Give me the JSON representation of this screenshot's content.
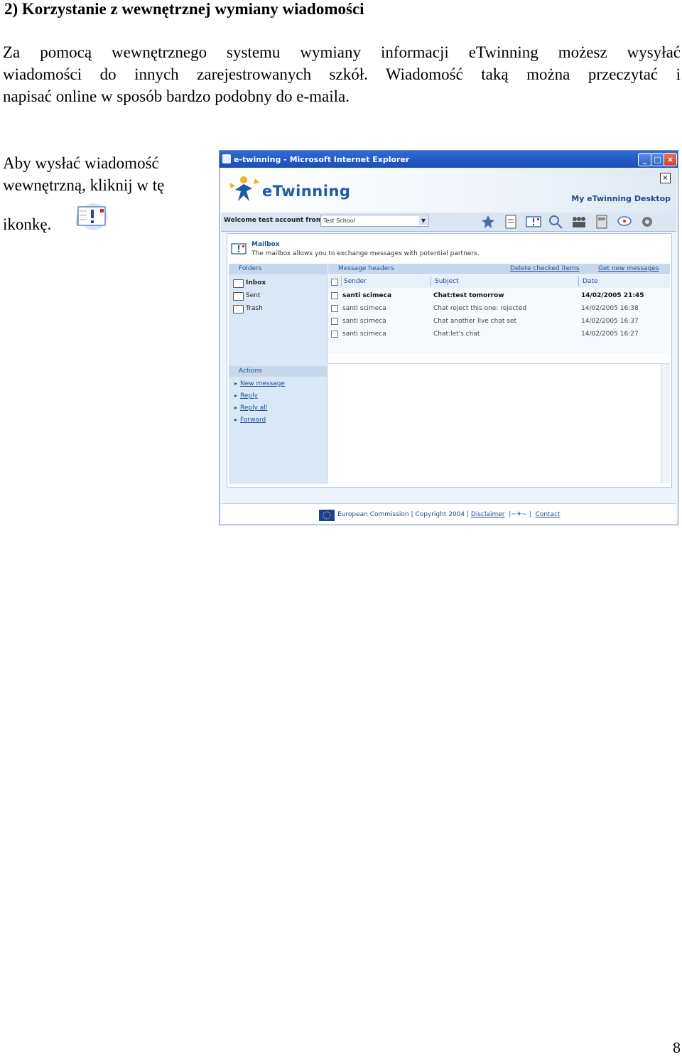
{
  "heading": "2) Korzystanie z wewnętrznej wymiany wiadomości",
  "paragraph_lines": [
    "Za pomocą wewnętrznego systemu wymiany informacji eTwinning możesz wysyłać",
    "wiadomości do innych zarejestrowanych szkół. Wiadomość taką można przeczytać i",
    "napisać online w sposób bardzo podobny do e-maila."
  ],
  "instruction_lines": [
    "Aby wysłać wiadomość",
    "wewnętrzną, kliknij w tę",
    "ikonkę."
  ],
  "page_number": "8",
  "screenshot": {
    "window_title": "e-twinning - Microsoft Internet Explorer",
    "logo_text": "eTwinning",
    "desktop_title": "My eTwinning Desktop",
    "welcome_label": "Welcome test account from",
    "school_value": "Test School",
    "mailbox_title": "Mailbox",
    "mailbox_desc": "The mailbox allows you to exchange messages with potential partners.",
    "folders_header": "Folders",
    "folders": [
      "Inbox",
      "Sent",
      "Trash"
    ],
    "actions_header": "Actions",
    "actions": [
      "New message",
      "Reply",
      "Reply all",
      "Forward"
    ],
    "message_headers_label": "Message headers",
    "delete_link": "Delete checked items",
    "get_link": "Get new messages",
    "columns": {
      "sender": "Sender",
      "subject": "Subject",
      "date": "Date"
    },
    "messages": [
      {
        "sender": "santi scimeca",
        "subject": "Chat:test tomorrow",
        "date": "14/02/2005 21:45",
        "unread": true
      },
      {
        "sender": "santi scimeca",
        "subject": "Chat reject this one: rejected",
        "date": "14/02/2005 16:38",
        "unread": false
      },
      {
        "sender": "santi scimeca",
        "subject": "Chat another live chat set",
        "date": "14/02/2005 16:37",
        "unread": false
      },
      {
        "sender": "santi scimeca",
        "subject": "Chat:let's chat",
        "date": "14/02/2005 16:27",
        "unread": false
      }
    ],
    "footer": {
      "commission": "European Commission | Copyright 2004 |",
      "disclaimer": "Disclaimer",
      "contact": "Contact"
    }
  }
}
